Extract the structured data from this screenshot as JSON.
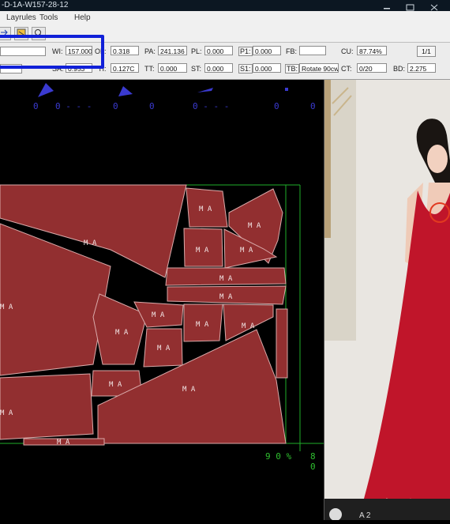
{
  "window": {
    "title": "-D-1A-W157-28-12"
  },
  "menu": {
    "items": [
      "Layrules",
      "Tools",
      "Help"
    ]
  },
  "params": {
    "wi_label": "WI:",
    "wi_value": "157.000",
    "ol_label": "OL:",
    "ol_value": "0.318",
    "pa_label": "PA:",
    "pa_value": "241.136",
    "pl_label": "PL:",
    "pl_value": "0.000",
    "p1_label": "P1:",
    "p1_value": "0.000",
    "fb_label": "FB:",
    "fb_value": "",
    "cu_label": "CU:",
    "cu_value": "87.74%",
    "ratio_button": "1/1",
    "sa_label": "SA:",
    "sa_value": "0.953",
    "ti_label": "TI:",
    "ti_value": "0.127C",
    "tt_label": "TT:",
    "tt_value": "0.000",
    "st_label": "ST:",
    "st_value": "0.000",
    "s1_label": "S1:",
    "s1_value": "0.000",
    "tb_label": "TB:",
    "tb_value": "Rotate 90cw",
    "ct_label": "CT:",
    "ct_value": "0/20",
    "bd_label": "BD:",
    "bd_value": "2.275"
  },
  "canvas": {
    "axis_numbers": [
      "0",
      "0 - - -",
      "0",
      "0",
      "0 - - -",
      "0",
      "0"
    ],
    "piece_label": "M A",
    "percent_label": "9 0 %",
    "percent_label_2": "8 0"
  },
  "photo": {
    "caption": "A 2"
  },
  "colors": {
    "piece_fill": "#922f30",
    "piece_edge": "#d9a9a9",
    "grid": "#1fae2a",
    "highlight": "#1020d8",
    "dress": "#c0152a"
  },
  "icons": {
    "toolbar": [
      "arrow-icon",
      "layout-icon",
      "zoom-icon"
    ]
  }
}
